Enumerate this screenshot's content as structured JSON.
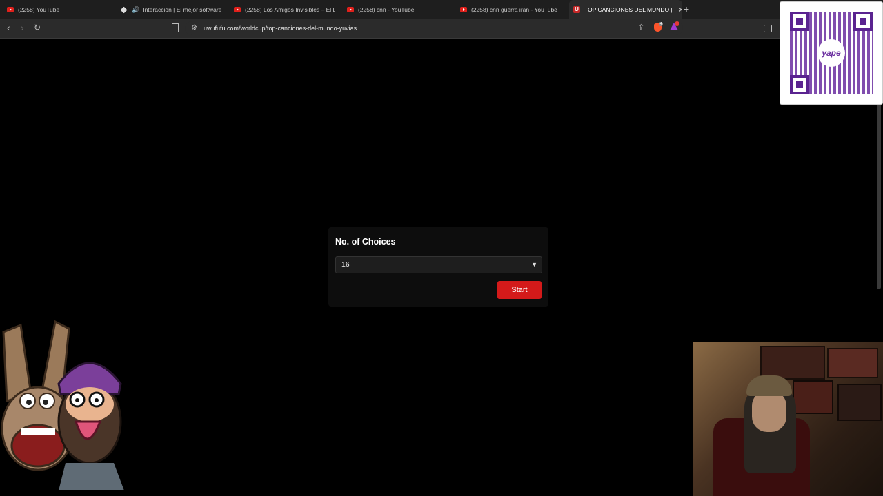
{
  "browser": {
    "tabs": [
      {
        "label": "(2258) YouTube",
        "icon": "youtube-icon"
      },
      {
        "label": "Interacción | El mejor software pa",
        "icon": "diamond-icon"
      },
      {
        "label": "(2258) Los Amigos Invisibles – El Dis",
        "icon": "youtube-icon"
      },
      {
        "label": "(2258) cnn - YouTube",
        "icon": "youtube-icon"
      },
      {
        "label": "(2258) cnn guerra iran - YouTube",
        "icon": "youtube-icon"
      },
      {
        "label": "TOP CANCIONES DEL MUNDO |",
        "icon": "uwufufu-icon",
        "active": true
      }
    ],
    "address": "uwufufu.com/worldcup/top-canciones-del-mundo-yuvias",
    "brave_badge": "4"
  },
  "page": {
    "panel_title": "No. of Choices",
    "choices_selected": "16",
    "start_label": "Start"
  },
  "overlay": {
    "qr_brand": "yape"
  },
  "colors": {
    "start_button": "#d41a1a",
    "qr_accent": "#6b2fa0",
    "background": "#000000"
  }
}
